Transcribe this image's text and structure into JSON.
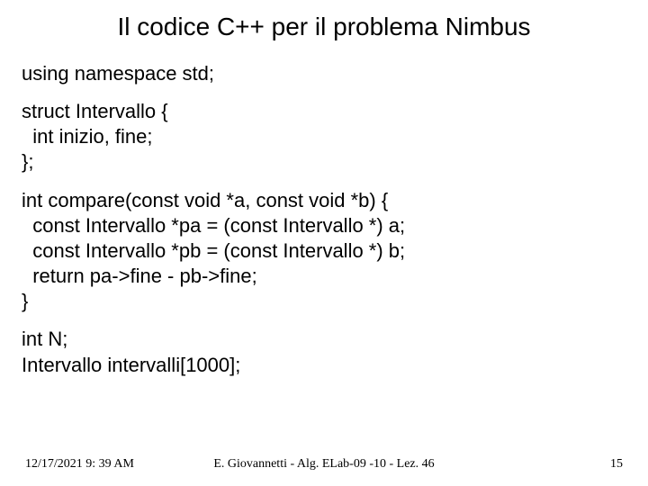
{
  "title": "Il codice C++ per il problema Nimbus",
  "code": {
    "block1": "using namespace std;",
    "block2": "struct Intervallo {\n  int inizio, fine;\n};",
    "block3": "int compare(const void *a, const void *b) {\n  const Intervallo *pa = (const Intervallo *) a;\n  const Intervallo *pb = (const Intervallo *) b;\n  return pa->fine - pb->fine;\n}",
    "block4": "int N;\nIntervallo intervalli[1000];"
  },
  "footer": {
    "date": "12/17/2021 9: 39 AM",
    "center": "E. Giovannetti - Alg. ELab-09 -10 - Lez. 46",
    "page": "15"
  }
}
